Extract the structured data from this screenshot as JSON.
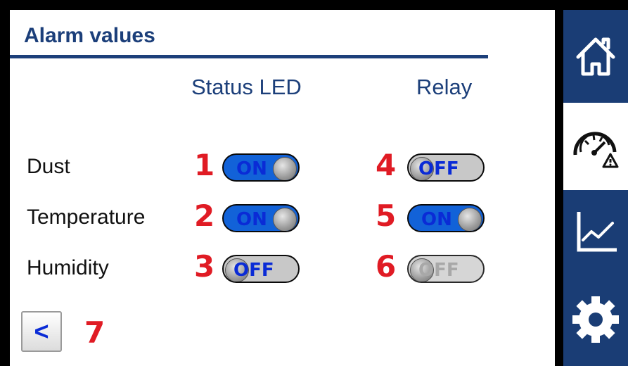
{
  "screen": {
    "title": "Alarm values",
    "columns": {
      "status_led": "Status LED",
      "relay": "Relay"
    }
  },
  "rows": [
    {
      "label": "Dust",
      "status_led": {
        "marker": "1",
        "state": "ON"
      },
      "relay": {
        "marker": "4",
        "state": "OFF"
      }
    },
    {
      "label": "Temperature",
      "status_led": {
        "marker": "2",
        "state": "ON"
      },
      "relay": {
        "marker": "5",
        "state": "ON"
      }
    },
    {
      "label": "Humidity",
      "status_led": {
        "marker": "3",
        "state": "OFF"
      },
      "relay": {
        "marker": "6",
        "state": "OFF",
        "disabled": true
      }
    }
  ],
  "back_button": {
    "label": "<",
    "marker": "7"
  },
  "sidebar": {
    "items": [
      {
        "icon": "home-icon",
        "active": false
      },
      {
        "icon": "alarm-gauge-icon",
        "active": true
      },
      {
        "icon": "chart-icon",
        "active": false
      },
      {
        "icon": "settings-gear-icon",
        "active": false
      }
    ]
  },
  "colors": {
    "accent": "#1c3f7a",
    "toggle_on": "#1262d8",
    "toggle_off": "#c8c8c8",
    "marker": "#e01b24"
  }
}
